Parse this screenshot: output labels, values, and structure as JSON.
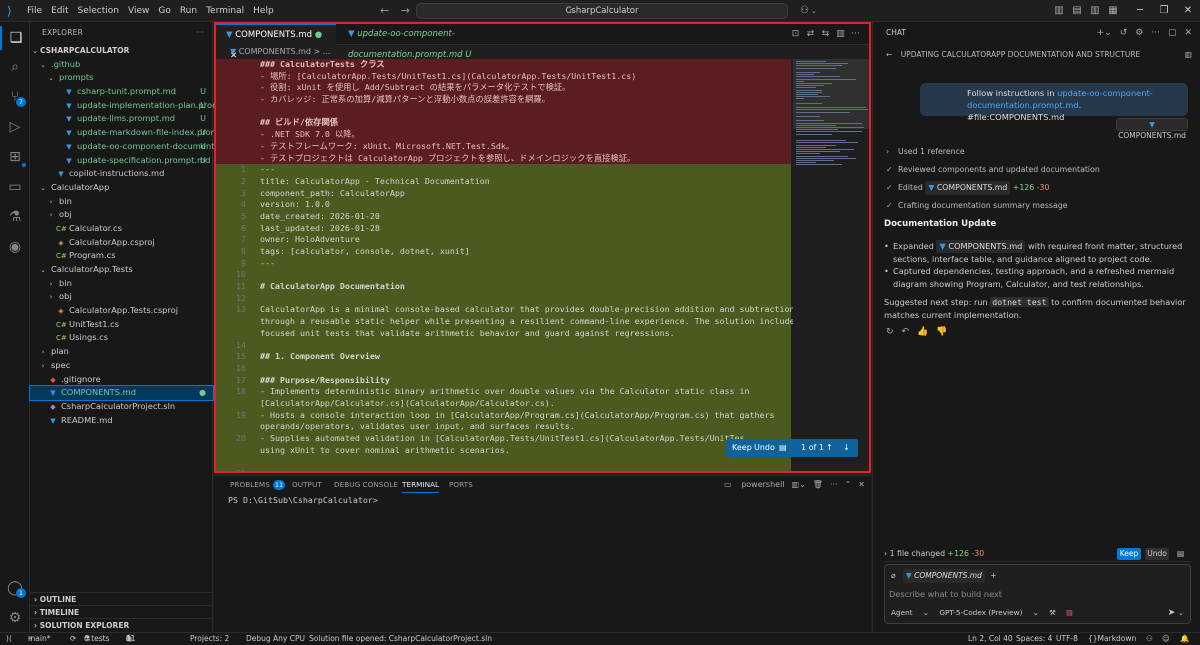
{
  "titlebar": {
    "menus": [
      "File",
      "Edit",
      "Selection",
      "View",
      "Go",
      "Run",
      "Terminal",
      "Help"
    ],
    "search": "CsharpCalculator"
  },
  "activity": {
    "scm_badge": "7",
    "accounts_badge": "1"
  },
  "explorer": {
    "header": "EXPLORER",
    "root": "CSHARPCALCULATOR",
    "tree": [
      {
        "label": ".github",
        "depth": 1,
        "kind": "folder-open",
        "status": "",
        "git": true
      },
      {
        "label": "prompts",
        "depth": 2,
        "kind": "folder-open",
        "status": "",
        "git": true
      },
      {
        "label": "csharp-tunit.prompt.md",
        "depth": 3,
        "kind": "md",
        "status": "U",
        "git": true
      },
      {
        "label": "update-implementation-plan.prompt....",
        "depth": 3,
        "kind": "md",
        "status": "U",
        "git": true
      },
      {
        "label": "update-llms.prompt.md",
        "depth": 3,
        "kind": "md",
        "status": "U",
        "git": true
      },
      {
        "label": "update-markdown-file-index.prompt....",
        "depth": 3,
        "kind": "md",
        "status": "U",
        "git": true
      },
      {
        "label": "update-oo-component-documentati...",
        "depth": 3,
        "kind": "md",
        "status": "U",
        "git": true
      },
      {
        "label": "update-specification.prompt.md",
        "depth": 3,
        "kind": "md",
        "status": "U",
        "git": true
      },
      {
        "label": "copilot-instructions.md",
        "depth": 2,
        "kind": "md",
        "status": "",
        "git": false
      },
      {
        "label": "CalculatorApp",
        "depth": 1,
        "kind": "folder-open",
        "status": "",
        "git": false
      },
      {
        "label": "bin",
        "depth": 2,
        "kind": "folder",
        "status": "",
        "git": false
      },
      {
        "label": "obj",
        "depth": 2,
        "kind": "folder",
        "status": "",
        "git": false
      },
      {
        "label": "Calculator.cs",
        "depth": 2,
        "kind": "cs",
        "status": "",
        "git": false
      },
      {
        "label": "CalculatorApp.csproj",
        "depth": 2,
        "kind": "proj",
        "status": "",
        "git": false
      },
      {
        "label": "Program.cs",
        "depth": 2,
        "kind": "cs",
        "status": "",
        "git": false
      },
      {
        "label": "CalculatorApp.Tests",
        "depth": 1,
        "kind": "folder-open",
        "status": "",
        "git": false
      },
      {
        "label": "bin",
        "depth": 2,
        "kind": "folder",
        "status": "",
        "git": false
      },
      {
        "label": "obj",
        "depth": 2,
        "kind": "folder",
        "status": "",
        "git": false
      },
      {
        "label": "CalculatorApp.Tests.csproj",
        "depth": 2,
        "kind": "proj",
        "status": "",
        "git": false
      },
      {
        "label": "UnitTest1.cs",
        "depth": 2,
        "kind": "cs",
        "status": "",
        "git": false
      },
      {
        "label": "Usings.cs",
        "depth": 2,
        "kind": "cs",
        "status": "",
        "git": false
      },
      {
        "label": "plan",
        "depth": 1,
        "kind": "folder",
        "status": "",
        "git": false
      },
      {
        "label": "spec",
        "depth": 1,
        "kind": "folder",
        "status": "",
        "git": false
      },
      {
        "label": ".gitignore",
        "depth": 1,
        "kind": "gitfile",
        "status": "",
        "git": false
      },
      {
        "label": "COMPONENTS.md",
        "depth": 1,
        "kind": "md",
        "status": "●",
        "git": true,
        "selected": true
      },
      {
        "label": "CsharpCalculatorProject.sln",
        "depth": 1,
        "kind": "sln",
        "status": "",
        "git": false
      },
      {
        "label": "README.md",
        "depth": 1,
        "kind": "md",
        "status": "",
        "git": false
      }
    ],
    "sections": [
      "OUTLINE",
      "TIMELINE",
      "SOLUTION EXPLORER"
    ]
  },
  "editor": {
    "tabs": [
      {
        "label": "COMPONENTS.md",
        "status": "●",
        "active": true
      },
      {
        "label": "update-oo-component-documentation.prompt.md",
        "status": "U",
        "active": false
      }
    ],
    "breadcrumb": "COMPONENTS.md > ...",
    "lines": [
      {
        "n": "",
        "kind": "del",
        "text": "### CalculatorTests クラス"
      },
      {
        "n": "",
        "kind": "del",
        "text": "- 場所: [CalculatorApp.Tests/UnitTest1.cs](CalculatorApp.Tests/UnitTest1.cs)"
      },
      {
        "n": "",
        "kind": "del",
        "text": "- 役割: xUnit を使用し Add/Subtract の結果をパラメータ化テストで検証。"
      },
      {
        "n": "",
        "kind": "del",
        "text": "- カバレッジ: 正常系の加算/減算パターンと浮動小数点の誤差許容を網羅。"
      },
      {
        "n": "",
        "kind": "del",
        "text": ""
      },
      {
        "n": "",
        "kind": "del",
        "text": "## ビルド/依存関係"
      },
      {
        "n": "",
        "kind": "del",
        "text": "- .NET SDK 7.0 以降。"
      },
      {
        "n": "",
        "kind": "del",
        "text": "- テストフレームワーク: xUnit、Microsoft.NET.Test.Sdk。"
      },
      {
        "n": "",
        "kind": "del",
        "text": "- テストプロジェクトは CalculatorApp プロジェクトを参照し、ドメインロジックを直接検証。"
      },
      {
        "n": "1",
        "kind": "add",
        "text": "---"
      },
      {
        "n": "2",
        "kind": "add",
        "text": "title: CalculatorApp - Technical Documentation"
      },
      {
        "n": "3",
        "kind": "add",
        "text": "component_path: CalculatorApp"
      },
      {
        "n": "4",
        "kind": "add",
        "text": "version: 1.0.0"
      },
      {
        "n": "5",
        "kind": "add",
        "text": "date_created: 2026-01-20"
      },
      {
        "n": "6",
        "kind": "add",
        "text": "last_updated: 2026-01-28"
      },
      {
        "n": "7",
        "kind": "add",
        "text": "owner: HoloAdventure"
      },
      {
        "n": "8",
        "kind": "add",
        "text": "tags: [calculator, console, dotnet, xunit]"
      },
      {
        "n": "9",
        "kind": "add",
        "text": "---"
      },
      {
        "n": "10",
        "kind": "add",
        "text": ""
      },
      {
        "n": "11",
        "kind": "add",
        "text": "# CalculatorApp Documentation"
      },
      {
        "n": "12",
        "kind": "add",
        "text": ""
      },
      {
        "n": "13",
        "kind": "add",
        "text": "CalculatorApp is a minimal console-based calculator that provides double-precision addition and subtraction"
      },
      {
        "n": "",
        "kind": "add",
        "text": "through a reusable static helper while presenting a resilient command-line experience. The solution includes"
      },
      {
        "n": "",
        "kind": "add",
        "text": "focused unit tests that validate arithmetic behavior and guard against regressions."
      },
      {
        "n": "14",
        "kind": "add",
        "text": ""
      },
      {
        "n": "15",
        "kind": "add",
        "text": "## 1. Component Overview"
      },
      {
        "n": "16",
        "kind": "add",
        "text": ""
      },
      {
        "n": "17",
        "kind": "add",
        "text": "### Purpose/Responsibility"
      },
      {
        "n": "18",
        "kind": "add",
        "text": "- Implements deterministic binary arithmetic over double values via the Calculator static class in"
      },
      {
        "n": "",
        "kind": "add",
        "text": "[CalculatorApp/Calculator.cs](CalculatorApp/Calculator.cs)."
      },
      {
        "n": "19",
        "kind": "add",
        "text": "- Hosts a console interaction loop in [CalculatorApp/Program.cs](CalculatorApp/Program.cs) that gathers"
      },
      {
        "n": "",
        "kind": "add",
        "text": "operands/operators, validates user input, and surfaces results."
      },
      {
        "n": "20",
        "kind": "add",
        "text": "- Supplies automated validation in [CalculatorApp.Tests/UnitTest1.cs](CalculatorApp.Tests/UnitTes"
      },
      {
        "n": "",
        "kind": "add",
        "text": "using xUnit to cover nominal arithmetic scenarios."
      },
      {
        "n": "",
        "kind": "add",
        "text": ""
      },
      {
        "n": "21",
        "kind": "add",
        "text": ""
      }
    ],
    "diff_bar": {
      "keep": "Keep",
      "undo": "Undo",
      "count": "1 of 1"
    }
  },
  "panel": {
    "tabs": [
      {
        "label": "PROBLEMS",
        "badge": "11"
      },
      {
        "label": "OUTPUT",
        "badge": ""
      },
      {
        "label": "DEBUG CONSOLE",
        "badge": ""
      },
      {
        "label": "TERMINAL",
        "badge": ""
      },
      {
        "label": "PORTS",
        "badge": ""
      }
    ],
    "terminal_profile": "powershell",
    "prompt": "PS D:\\GitSub\\CsharpCalculator>"
  },
  "chat": {
    "title": "CHAT",
    "session": "UPDATING CALCULATORAPP DOCUMENTATION AND STRUCTURE",
    "user_msg_pre": "Follow instructions in ",
    "user_msg_link": "update-oo-component-documentation.prompt.md",
    "user_msg_post": ".",
    "user_msg_line2": "#file:COMPONENTS.md",
    "ref_chip": "COMPONENTS.md",
    "steps": [
      {
        "mark": "›",
        "text": "Used 1 reference"
      },
      {
        "mark": "✓",
        "text": "Reviewed components and updated documentation"
      },
      {
        "mark": "✓",
        "text": "Edited",
        "file": "COMPONENTS.md",
        "plus": "+126",
        "minus": "-30"
      },
      {
        "mark": "✓",
        "text": "Crafting documentation summary message"
      }
    ],
    "heading": "Documentation Update",
    "bullet1_pre": "Expanded",
    "bullet1_file": "COMPONENTS.md",
    "bullet1_post": "with required front matter, structured sections, interface table, and guidance aligned to project code.",
    "bullet2": "Captured dependencies, testing approach, and a refreshed mermaid diagram showing Program, Calculator, and test relationships.",
    "next_pre": "Suggested next step: run",
    "next_code": "dotnet test",
    "next_post": "to confirm documented behavior matches current implementation.",
    "changed_label": "1 file changed",
    "changed_plus": "+126",
    "changed_minus": "-30",
    "keep": "Keep",
    "undo": "Undo",
    "context_file": "COMPONENTS.md",
    "input_placeholder": "Describe what to build next",
    "mode": "Agent",
    "model": "GPT-5-Codex (Preview)"
  },
  "status": {
    "branch": "main*",
    "tests": "6 tests",
    "errors": "0",
    "warnings": "0",
    "info": "11",
    "projects": "Projects: 2",
    "config": "Debug Any CPU",
    "solution": "Solution file opened: CsharpCalculatorProject.sln",
    "position": "Ln 2, Col 40",
    "spaces": "Spaces: 4",
    "encoding": "UTF-8",
    "language": "Markdown"
  },
  "colors": {
    "accent": "#0078d4",
    "deleted_bg": "#5b1d1f",
    "added_bg": "#4b5a1e",
    "highlight_border": "#e2242a",
    "git_untracked": "#73c991"
  }
}
